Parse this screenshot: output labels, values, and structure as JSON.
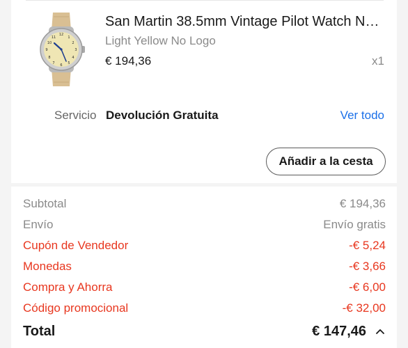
{
  "product": {
    "title": "San Martin 38.5mm Vintage Pilot Watch NH…",
    "variant": "Light Yellow No Logo",
    "price": "€ 194,36",
    "quantity": "x1"
  },
  "service": {
    "label": "Servicio",
    "value": "Devolución Gratuita",
    "link": "Ver todo"
  },
  "add_to_cart_label": "Añadir a la cesta",
  "summary": {
    "rows": [
      {
        "label": "Subtotal",
        "value": "€ 194,36"
      },
      {
        "label": "Envío",
        "value": "Envío gratis"
      },
      {
        "label": "Cupón de Vendedor",
        "value": "-€ 5,24"
      },
      {
        "label": "Monedas",
        "value": "-€ 3,66"
      },
      {
        "label": "Compra y Ahorra",
        "value": "-€ 6,00"
      },
      {
        "label": "Código promocional",
        "value": "-€ 32,00"
      }
    ],
    "total_label": "Total",
    "total_value": "€ 147,46"
  },
  "colors": {
    "link": "#1a6fe8",
    "discount": "#e8371f",
    "muted": "#8a8a8a"
  },
  "icons": {
    "collapse": "chevron-up-icon",
    "product_image": "pilot-watch-thumbnail"
  }
}
